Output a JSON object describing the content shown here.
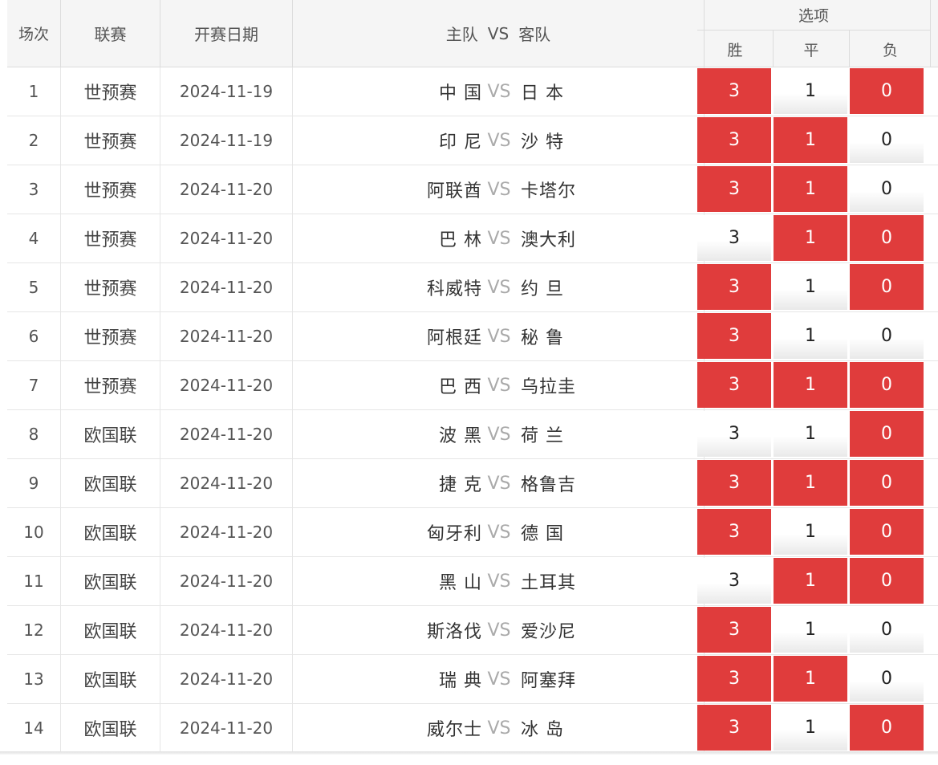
{
  "header": {
    "no": "场次",
    "league": "联赛",
    "date": "开赛日期",
    "home": "主队",
    "vs": "VS",
    "away": "客队",
    "options_title": "选项",
    "opt_win": "胜",
    "opt_draw": "平",
    "opt_lose": "负"
  },
  "colors": {
    "selected": "#e03c3c"
  },
  "rows": [
    {
      "no": "1",
      "league": "世预赛",
      "date": "2024-11-19",
      "home": "中 国",
      "away": "日 本",
      "win": "3",
      "draw": "1",
      "lose": "0",
      "sel": [
        true,
        false,
        true
      ]
    },
    {
      "no": "2",
      "league": "世预赛",
      "date": "2024-11-19",
      "home": "印 尼",
      "away": "沙 特",
      "win": "3",
      "draw": "1",
      "lose": "0",
      "sel": [
        true,
        true,
        false
      ]
    },
    {
      "no": "3",
      "league": "世预赛",
      "date": "2024-11-20",
      "home": "阿联酋",
      "away": "卡塔尔",
      "win": "3",
      "draw": "1",
      "lose": "0",
      "sel": [
        true,
        true,
        false
      ]
    },
    {
      "no": "4",
      "league": "世预赛",
      "date": "2024-11-20",
      "home": "巴 林",
      "away": "澳大利",
      "win": "3",
      "draw": "1",
      "lose": "0",
      "sel": [
        false,
        true,
        true
      ]
    },
    {
      "no": "5",
      "league": "世预赛",
      "date": "2024-11-20",
      "home": "科威特",
      "away": "约 旦",
      "win": "3",
      "draw": "1",
      "lose": "0",
      "sel": [
        true,
        false,
        true
      ]
    },
    {
      "no": "6",
      "league": "世预赛",
      "date": "2024-11-20",
      "home": "阿根廷",
      "away": "秘 鲁",
      "win": "3",
      "draw": "1",
      "lose": "0",
      "sel": [
        true,
        false,
        false
      ]
    },
    {
      "no": "7",
      "league": "世预赛",
      "date": "2024-11-20",
      "home": "巴 西",
      "away": "乌拉圭",
      "win": "3",
      "draw": "1",
      "lose": "0",
      "sel": [
        true,
        true,
        true
      ]
    },
    {
      "no": "8",
      "league": "欧国联",
      "date": "2024-11-20",
      "home": "波 黑",
      "away": "荷 兰",
      "win": "3",
      "draw": "1",
      "lose": "0",
      "sel": [
        false,
        false,
        true
      ]
    },
    {
      "no": "9",
      "league": "欧国联",
      "date": "2024-11-20",
      "home": "捷 克",
      "away": "格鲁吉",
      "win": "3",
      "draw": "1",
      "lose": "0",
      "sel": [
        true,
        true,
        true
      ]
    },
    {
      "no": "10",
      "league": "欧国联",
      "date": "2024-11-20",
      "home": "匈牙利",
      "away": "德 国",
      "win": "3",
      "draw": "1",
      "lose": "0",
      "sel": [
        true,
        false,
        true
      ]
    },
    {
      "no": "11",
      "league": "欧国联",
      "date": "2024-11-20",
      "home": "黑 山",
      "away": "土耳其",
      "win": "3",
      "draw": "1",
      "lose": "0",
      "sel": [
        false,
        true,
        true
      ]
    },
    {
      "no": "12",
      "league": "欧国联",
      "date": "2024-11-20",
      "home": "斯洛伐",
      "away": "爱沙尼",
      "win": "3",
      "draw": "1",
      "lose": "0",
      "sel": [
        true,
        false,
        false
      ]
    },
    {
      "no": "13",
      "league": "欧国联",
      "date": "2024-11-20",
      "home": "瑞 典",
      "away": "阿塞拜",
      "win": "3",
      "draw": "1",
      "lose": "0",
      "sel": [
        true,
        true,
        false
      ]
    },
    {
      "no": "14",
      "league": "欧国联",
      "date": "2024-11-20",
      "home": "威尔士",
      "away": "冰 岛",
      "win": "3",
      "draw": "1",
      "lose": "0",
      "sel": [
        true,
        false,
        true
      ]
    }
  ]
}
